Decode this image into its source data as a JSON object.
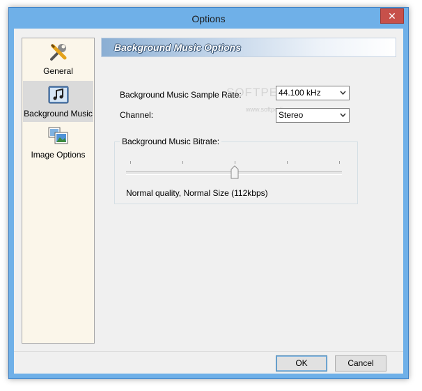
{
  "window": {
    "title": "Options",
    "close_glyph": "✕"
  },
  "sidebar": {
    "items": [
      {
        "label": "General",
        "icon": "tools-icon",
        "selected": false
      },
      {
        "label": "Background Music",
        "icon": "music-note-icon",
        "selected": true
      },
      {
        "label": "Image Options",
        "icon": "image-gallery-icon",
        "selected": false
      }
    ]
  },
  "panel": {
    "title": "Background Music Options",
    "sample_rate": {
      "label": "Background Music Sample Rate:",
      "value": "44.100 kHz"
    },
    "channel": {
      "label": "Channel:",
      "value": "Stereo"
    },
    "bitrate": {
      "group_label": "Background Music Bitrate:",
      "status": "Normal quality, Normal Size (112kbps)",
      "level_fraction": 0.5,
      "tick_count": 5
    }
  },
  "watermark": {
    "text": "SOFTPEDIA",
    "subtext": "www.softpedia.com"
  },
  "buttons": {
    "ok": "OK",
    "cancel": "Cancel"
  },
  "colors": {
    "accent": "#6fb0e8",
    "close": "#c7504a",
    "sidebar_bg": "#fbf6ea"
  }
}
